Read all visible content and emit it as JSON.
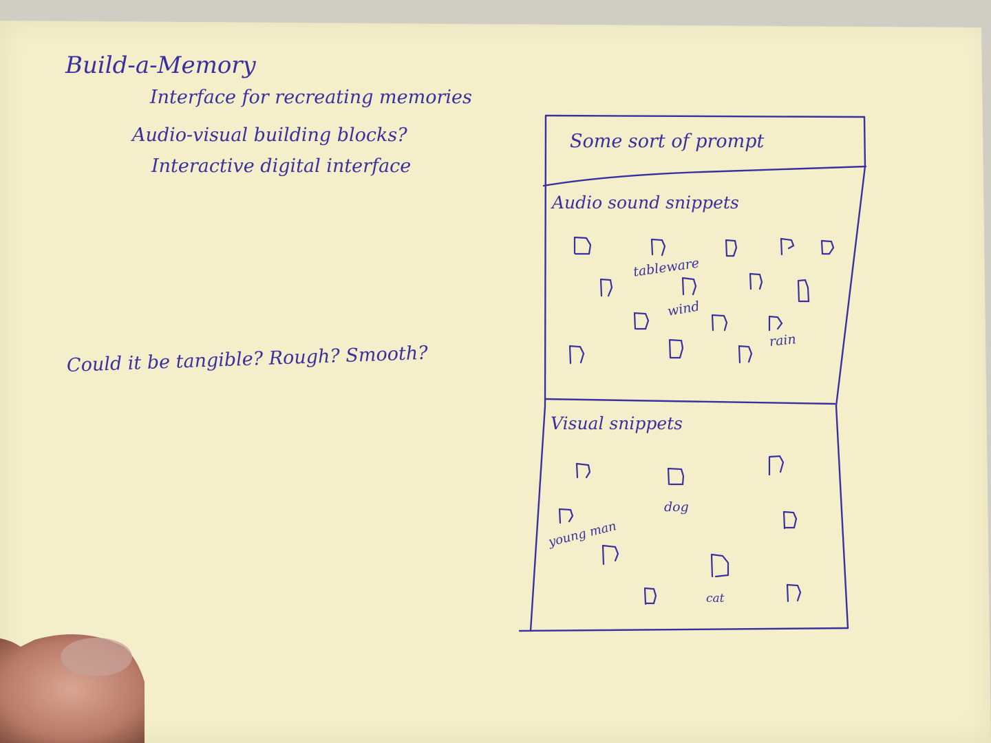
{
  "notes": {
    "title": "Build-a-Memory",
    "line1": "Interface for recreating memories",
    "line2": "Audio-visual building blocks?",
    "line3": "Interactive digital interface",
    "line4": "Could it be tangible? Rough? Smooth?"
  },
  "sketch": {
    "prompt": "Some sort of prompt",
    "audio_section": "Audio sound snippets",
    "audio_labels": [
      "tableware",
      "wind",
      "rain"
    ],
    "visual_section": "Visual snippets",
    "visual_labels": [
      "dog",
      "young man",
      "cat"
    ]
  },
  "colors": {
    "ink": "#3a2fa0",
    "paper": "#f4efca",
    "background": "#cfcdc4"
  }
}
